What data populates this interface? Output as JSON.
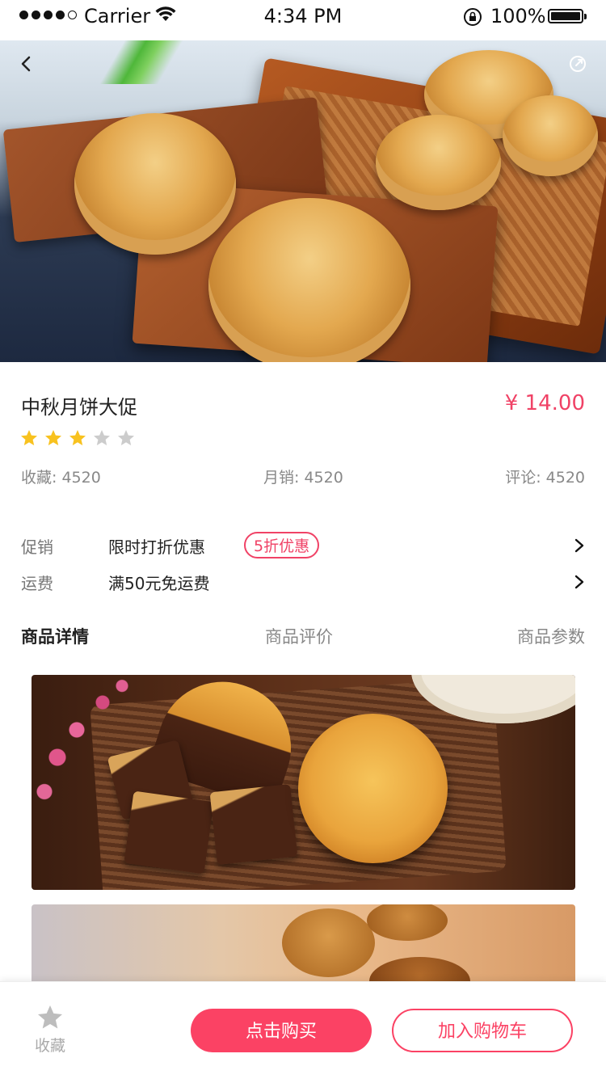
{
  "status_bar": {
    "carrier": "Carrier",
    "time": "4:34 PM",
    "battery": "100%"
  },
  "hero": {
    "back_icon": "chevron-left-icon",
    "share_icon": "share-icon"
  },
  "product": {
    "title": "中秋月饼大促",
    "price": "¥ 14.00",
    "rating": 3,
    "rating_max": 5,
    "stats": {
      "favorites": "收藏: 4520",
      "monthly_sales": "月销: 4520",
      "comments": "评论: 4520"
    }
  },
  "promo": {
    "label": "促销",
    "value": "限时打折优惠",
    "tag": "5折优惠"
  },
  "shipping": {
    "label": "运费",
    "value": "满50元免运费"
  },
  "tabs": [
    {
      "label": "商品详情",
      "active": true
    },
    {
      "label": "商品评价",
      "active": false
    },
    {
      "label": "商品参数",
      "active": false
    }
  ],
  "bottom_bar": {
    "favorite_label": "收藏",
    "buy_label": "点击购买",
    "cart_label": "加入购物车"
  },
  "colors": {
    "accent": "#f04266",
    "button": "#fb4264",
    "star_on": "#f8c21f",
    "star_off": "#cccccc"
  }
}
